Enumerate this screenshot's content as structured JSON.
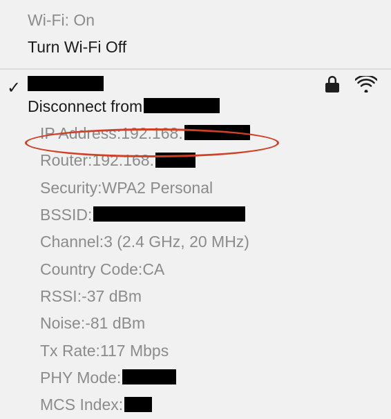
{
  "header": {
    "wifi_status": "Wi-Fi: On",
    "turn_off_label": "Turn Wi-Fi Off"
  },
  "network": {
    "disconnect_prefix": "Disconnect from ",
    "details": {
      "ip_label": "IP Address",
      "ip_value": "192.168.",
      "router_label": "Router",
      "router_value": "192.168.",
      "security_label": "Security",
      "security_value": "WPA2 Personal",
      "bssid_label": "BSSID",
      "bssid_value": "",
      "channel_label": "Channel",
      "channel_value": "3 (2.4 GHz, 20 MHz)",
      "country_label": "Country Code",
      "country_value": "CA",
      "rssi_label": "RSSI",
      "rssi_value": "-37 dBm",
      "noise_label": "Noise",
      "noise_value": "-81 dBm",
      "txrate_label": "Tx Rate",
      "txrate_value": "117 Mbps",
      "phy_label": "PHY Mode",
      "phy_value": "",
      "mcs_label": "MCS Index",
      "mcs_value": ""
    }
  }
}
